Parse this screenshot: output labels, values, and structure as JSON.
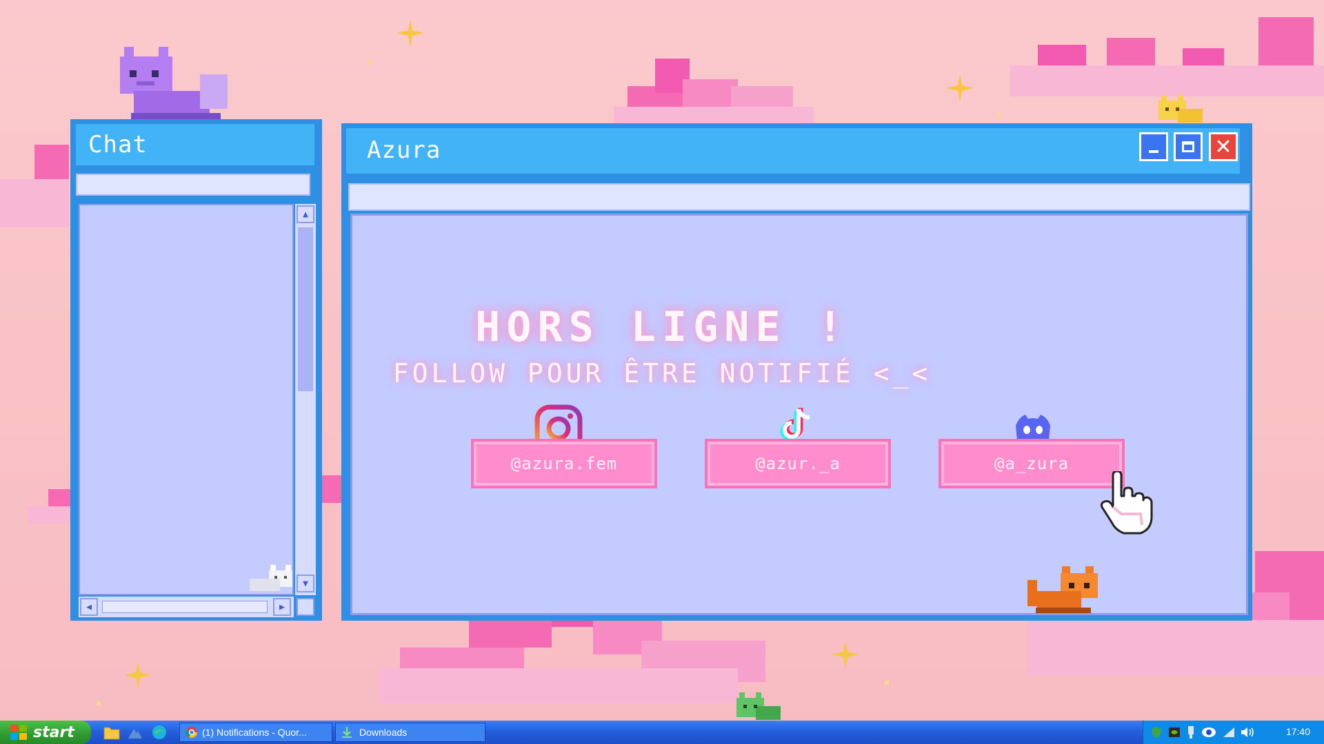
{
  "chat_window": {
    "title": "Chat"
  },
  "main_window": {
    "title": "Azura",
    "controls": {
      "minimize": "minimize",
      "maximize": "maximize",
      "close": "close"
    }
  },
  "offline": {
    "headline": "HORS LIGNE !",
    "subline": "FOLLOW POUR ÊTRE NOTIFIÉ <_<"
  },
  "socials": [
    {
      "icon": "instagram-icon",
      "handle": "@azura.fem"
    },
    {
      "icon": "tiktok-icon",
      "handle": "@azur._a"
    },
    {
      "icon": "discord-icon",
      "handle": "@a_zura"
    }
  ],
  "taskbar": {
    "start_label": "start",
    "items": [
      {
        "label": "(1) Notifications - Quor..."
      },
      {
        "label": "Downloads"
      }
    ],
    "clock": "17:40"
  },
  "colors": {
    "background": "#fbc9cd",
    "window_frame": "#2f8fe3",
    "title_bar": "#42b3f6",
    "panel": "#c3cbff",
    "button_pink": "#ff8ccc",
    "close_red": "#e8453c",
    "taskbar": "#245ddb"
  }
}
